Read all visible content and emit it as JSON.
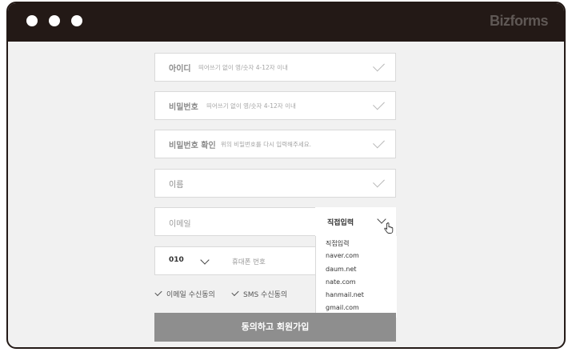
{
  "window": {
    "brand": "Bizforms"
  },
  "form": {
    "userid": {
      "label": "아이디",
      "hint": "띄어쓰기 없이 영/숫자 4-12자 이내"
    },
    "password": {
      "label": "비밀번호",
      "hint": "띄어쓰기 없이 영/숫자 4-12자 이내"
    },
    "password_confirm": {
      "label": "비밀번호 확인",
      "hint": "위의 비밀번호를 다시 입력해주세요."
    },
    "name": {
      "label": "이름"
    },
    "email": {
      "placeholder": "이메일",
      "domain_selected": "직접입력",
      "domain_options": [
        "직접입력",
        "naver.com",
        "daum.net",
        "nate.com",
        "hanmail.net",
        "gmail.com"
      ]
    },
    "phone": {
      "prefix": "010",
      "placeholder": "휴대폰 번호"
    },
    "agreements": {
      "email": "이메일 수신동의",
      "sms": "SMS 수신동의"
    },
    "submit_label": "동의하고 회원가입"
  }
}
